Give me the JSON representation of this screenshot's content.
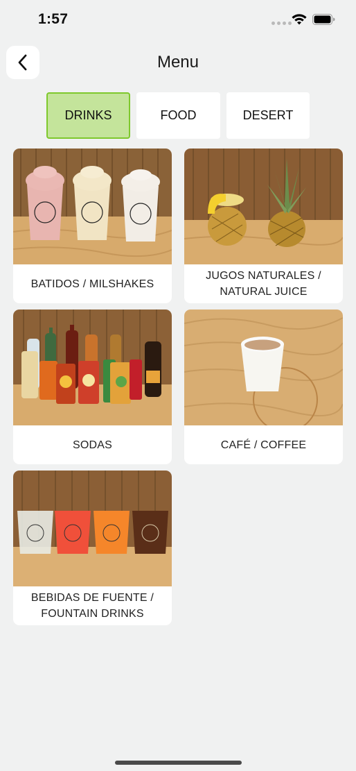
{
  "status_bar": {
    "time": "1:57"
  },
  "header": {
    "title": "Menu"
  },
  "tabs": [
    {
      "label": "DRINKS",
      "selected": true
    },
    {
      "label": "FOOD",
      "selected": false
    },
    {
      "label": "DESERT",
      "selected": false
    }
  ],
  "categories": [
    {
      "label": "BATIDOS / MILSHAKES"
    },
    {
      "label": "JUGOS NATURALES /\nNATURAL JUICE"
    },
    {
      "label": "SODAS"
    },
    {
      "label": "CAFÉ / COFFEE"
    },
    {
      "label": "BEBIDAS DE FUENTE /\nFOUNTAIN DRINKS"
    }
  ],
  "colors": {
    "background": "#f0f1f1",
    "selected_tab_fill": "#c4e49b",
    "selected_tab_border": "#7ec82c"
  },
  "icons": [
    "back-chevron-icon",
    "wifi-icon",
    "battery-icon",
    "signal-dots-icon"
  ]
}
